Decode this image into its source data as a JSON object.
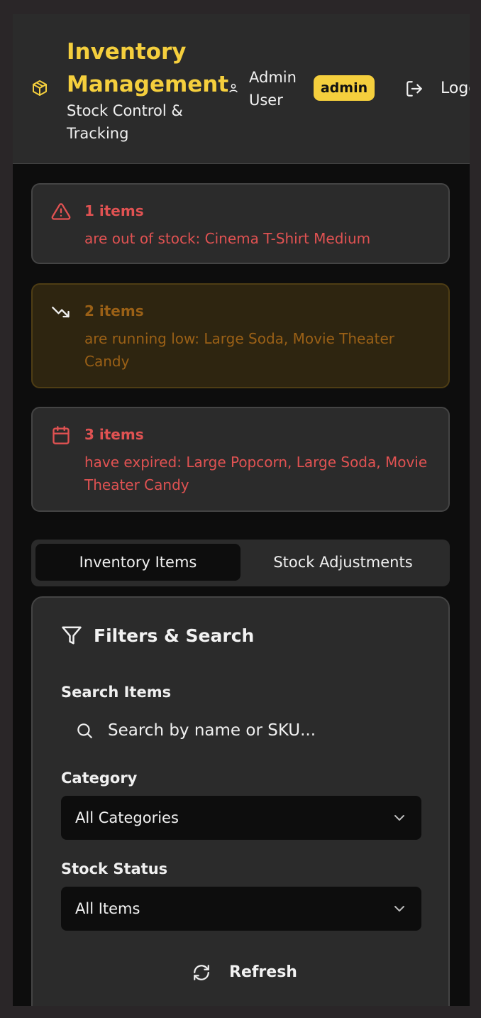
{
  "header": {
    "title": "Inventory Management",
    "subtitle": "Stock Control & Tracking",
    "user_name": "Admin User",
    "role_badge": "admin",
    "logout_label": "Logout",
    "accent_color": "#f5cf3d"
  },
  "alerts": [
    {
      "icon": "alert-triangle-icon",
      "count": "1 items",
      "text": "are out of stock: Cinema T-Shirt Medium",
      "color": "#e05252"
    },
    {
      "icon": "trending-down-icon",
      "count": "2 items",
      "text": "are running low: Large Soda, Movie Theater Candy",
      "color": "#9a6016"
    },
    {
      "icon": "calendar-icon",
      "count": "3 items",
      "text": "have expired: Large Popcorn, Large Soda, Movie Theater Candy",
      "color": "#e05252"
    }
  ],
  "tabs": [
    {
      "label": "Inventory Items",
      "active": true
    },
    {
      "label": "Stock Adjustments",
      "active": false
    }
  ],
  "filters": {
    "title": "Filters & Search",
    "search_label": "Search Items",
    "search_placeholder": "Search by name or SKU...",
    "category_label": "Category",
    "category_value": "All Categories",
    "status_label": "Stock Status",
    "status_value": "All Items",
    "refresh_label": "Refresh"
  }
}
